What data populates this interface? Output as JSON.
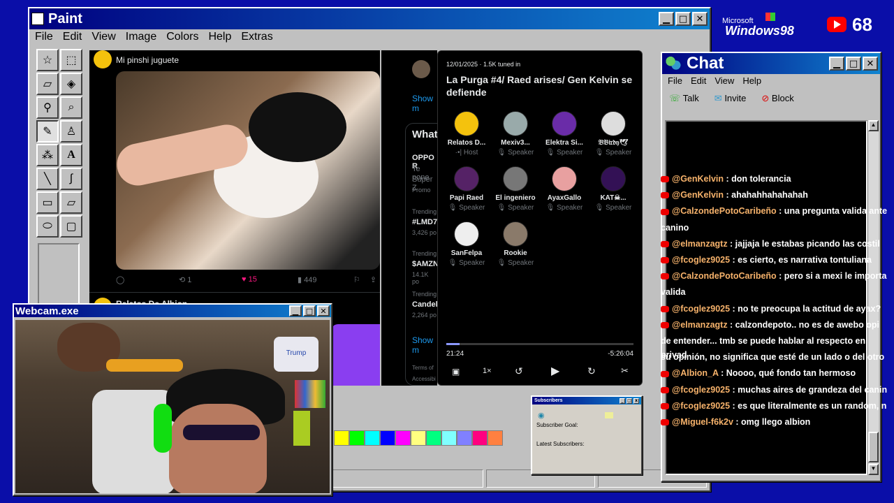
{
  "desktop": {
    "os_name": "Windows98",
    "os_brand": "Microsoft",
    "youtube_count": "68"
  },
  "paint": {
    "title": "Paint",
    "menu": [
      "File",
      "Edit",
      "View",
      "Image",
      "Colors",
      "Help",
      "Extras"
    ],
    "palette": [
      "#ffff00",
      "#00ff00",
      "#00ffff",
      "#0000ff",
      "#ff00ff",
      "#ffff80",
      "#00ff80",
      "#80ffff",
      "#8080ff",
      "#ff0080",
      "#ff8040"
    ]
  },
  "tweet": {
    "text": "Mi pinshi juguete",
    "reposts": "1",
    "likes": "15",
    "views": "449",
    "next_author": "Relatos De Albion"
  },
  "trends": {
    "show_more": "Show m",
    "whats": "What",
    "item1": "OPPO R",
    "item1_sub": "Te pone",
    "item1_sub2": "Súper Z",
    "promo": "Promo",
    "t1_label": "Trending",
    "t1": "#LMD7",
    "t1_count": "3,426 po",
    "t2_label": "Trending",
    "t2": "$AMZN",
    "t2_count": "14.1K po",
    "t3_label": "Trending",
    "t3": "Candel",
    "t3_count": "2,264 po",
    "show_more2": "Show m",
    "terms": "Terms of",
    "access": "Accessibi"
  },
  "space": {
    "meta": "12/01/2025 · 1.5K tuned in",
    "title": "La Purga #4/ Raed arises/ Gen Kelvin se defiende",
    "speakers": [
      {
        "name": "Relatos D...",
        "role": "Host",
        "color": "#f4c20d"
      },
      {
        "name": "Mexiv3...",
        "role": "Speaker",
        "color": "#9aa"
      },
      {
        "name": "Elektra Si...",
        "role": "Speaker",
        "color": "#6a2ca8"
      },
      {
        "name": "𝔅𝔅𝔦𝔯𝔡𝔶🕊",
        "role": "Speaker",
        "color": "#ddd"
      },
      {
        "name": "Papi Raed",
        "role": "Speaker",
        "color": "#552266"
      },
      {
        "name": "El ingeniero",
        "role": "Speaker",
        "color": "#777"
      },
      {
        "name": "AyaxGallo",
        "role": "Speaker",
        "color": "#e8a0a0"
      },
      {
        "name": "KAT☠...",
        "role": "Speaker",
        "color": "#331155"
      },
      {
        "name": "SanFelpa",
        "role": "Speaker",
        "color": "#eee"
      },
      {
        "name": "Rookie",
        "role": "Speaker",
        "color": "#8a7a6a"
      }
    ],
    "elapsed": "21:24",
    "remaining": "-5:26:04",
    "speed": "1×"
  },
  "chat": {
    "title": "Chat",
    "menu": [
      "File",
      "Edit",
      "View",
      "Help"
    ],
    "toolbar": {
      "talk": "Talk",
      "invite": "Invite",
      "block": "Block"
    },
    "messages": [
      {
        "user": "@GenKelvin",
        "text": ": don tolerancia"
      },
      {
        "user": "@GenKelvin",
        "text": ": ahahahhahahahah"
      },
      {
        "user": "@CalzondePotoCaribeño",
        "text": ": una pregunta valida ante"
      },
      {
        "user": "",
        "text": "canino"
      },
      {
        "user": "@elmanzagtz",
        "text": ": jajjaja le estabas picando las costil"
      },
      {
        "user": "@fcoglez9025",
        "text": ": es cierto, es narrativa tontuliana"
      },
      {
        "user": "@CalzondePotoCaribeño",
        "text": ": pero si a mexi le importa"
      },
      {
        "user": "",
        "text": "valida"
      },
      {
        "user": "@fcoglez9025",
        "text": ": no te preocupa la actitud de ayax?"
      },
      {
        "user": "@elmanzagtz",
        "text": ": calzondepoto.. no es de awebo opi"
      },
      {
        "user": "",
        "text": "de entender... tmb se puede hablar al respecto en privad"
      },
      {
        "user": "",
        "text": "su opinión, no significa que esté de un lado o del otro"
      },
      {
        "user": "@Albion_A",
        "text": ": Noooo, qué fondo tan hermoso"
      },
      {
        "user": "@fcoglez9025",
        "text": ": muchas aires de grandeza del canin"
      },
      {
        "user": "@fcoglez9025",
        "text": ": es que literalmente es un random, n"
      },
      {
        "user": "@Miguel-f6k2v",
        "text": ": omg llego albion"
      }
    ]
  },
  "webcam": {
    "title": "Webcam.exe",
    "jar_label": "Trump"
  },
  "subscribers": {
    "title": "Subscribers",
    "goal": "Subscriber Goal:",
    "latest": "Latest Subscribers:"
  }
}
